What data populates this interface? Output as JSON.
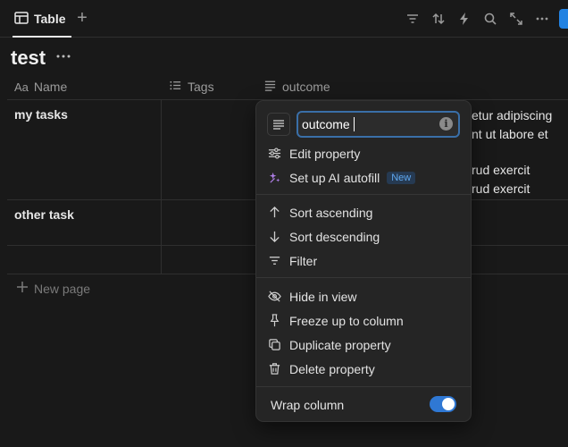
{
  "view": {
    "tab_label": "Table",
    "add_view_icon": "plus-icon"
  },
  "toolbar": {
    "icons": [
      "filter-icon",
      "sort-icon",
      "lightning-icon",
      "search-icon",
      "resize-icon",
      "more-icon"
    ]
  },
  "page": {
    "title": "test",
    "more_icon": "more-icon"
  },
  "table": {
    "columns": [
      {
        "label": "Name",
        "prefix": "Aa"
      },
      {
        "label": "Tags"
      },
      {
        "label": "outcome"
      }
    ],
    "rows": [
      {
        "name": "my tasks",
        "outcome_lines": [
          "etur adipiscing",
          "nt ut labore et",
          "",
          "rud exercit",
          "rud exercit"
        ]
      },
      {
        "name": "other task"
      },
      {
        "name": ""
      }
    ],
    "new_page_label": "New page"
  },
  "menu": {
    "name_value": "outcome",
    "items": [
      {
        "label": "Edit property",
        "icon": "sliders-icon"
      },
      {
        "label": "Set up AI autofill",
        "icon": "sparkle-icon",
        "badge": "New"
      },
      {
        "label": "Sort ascending",
        "icon": "arrow-up-icon"
      },
      {
        "label": "Sort descending",
        "icon": "arrow-down-icon"
      },
      {
        "label": "Filter",
        "icon": "filter-icon"
      },
      {
        "label": "Hide in view",
        "icon": "eye-slash-icon"
      },
      {
        "label": "Freeze up to column",
        "icon": "pin-icon"
      },
      {
        "label": "Duplicate property",
        "icon": "duplicate-icon"
      },
      {
        "label": "Delete property",
        "icon": "trash-icon"
      }
    ],
    "wrap_label": "Wrap column",
    "wrap_on": true
  },
  "colors": {
    "accent": "#2f78d4",
    "background": "#191919",
    "menu_bg": "#252525",
    "badge_text": "#5fa8f0"
  }
}
